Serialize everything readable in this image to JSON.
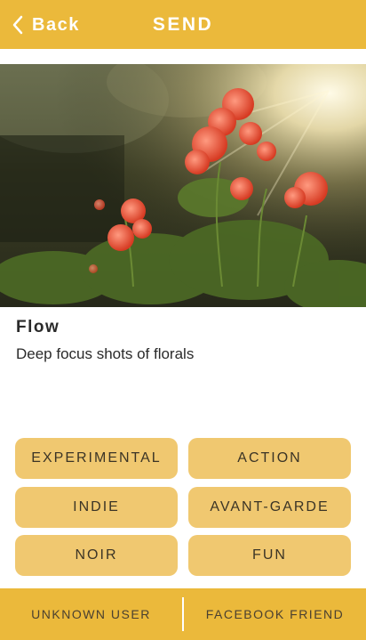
{
  "header": {
    "back_label": "Back",
    "title": "SEND"
  },
  "item": {
    "name": "Flow",
    "description": "Deep focus shots of florals"
  },
  "tags": [
    "EXPERIMENTAL",
    "ACTION",
    "INDIE",
    "AVANT-GARDE",
    "NOIR",
    "FUN"
  ],
  "footer": {
    "left_label": "UNKNOWN USER",
    "right_label": "FACEBOOK FRIEND"
  },
  "colors": {
    "accent": "#ebb93b",
    "tag_bg": "#f0c870"
  },
  "icons": {
    "back": "chevron-left-icon"
  }
}
